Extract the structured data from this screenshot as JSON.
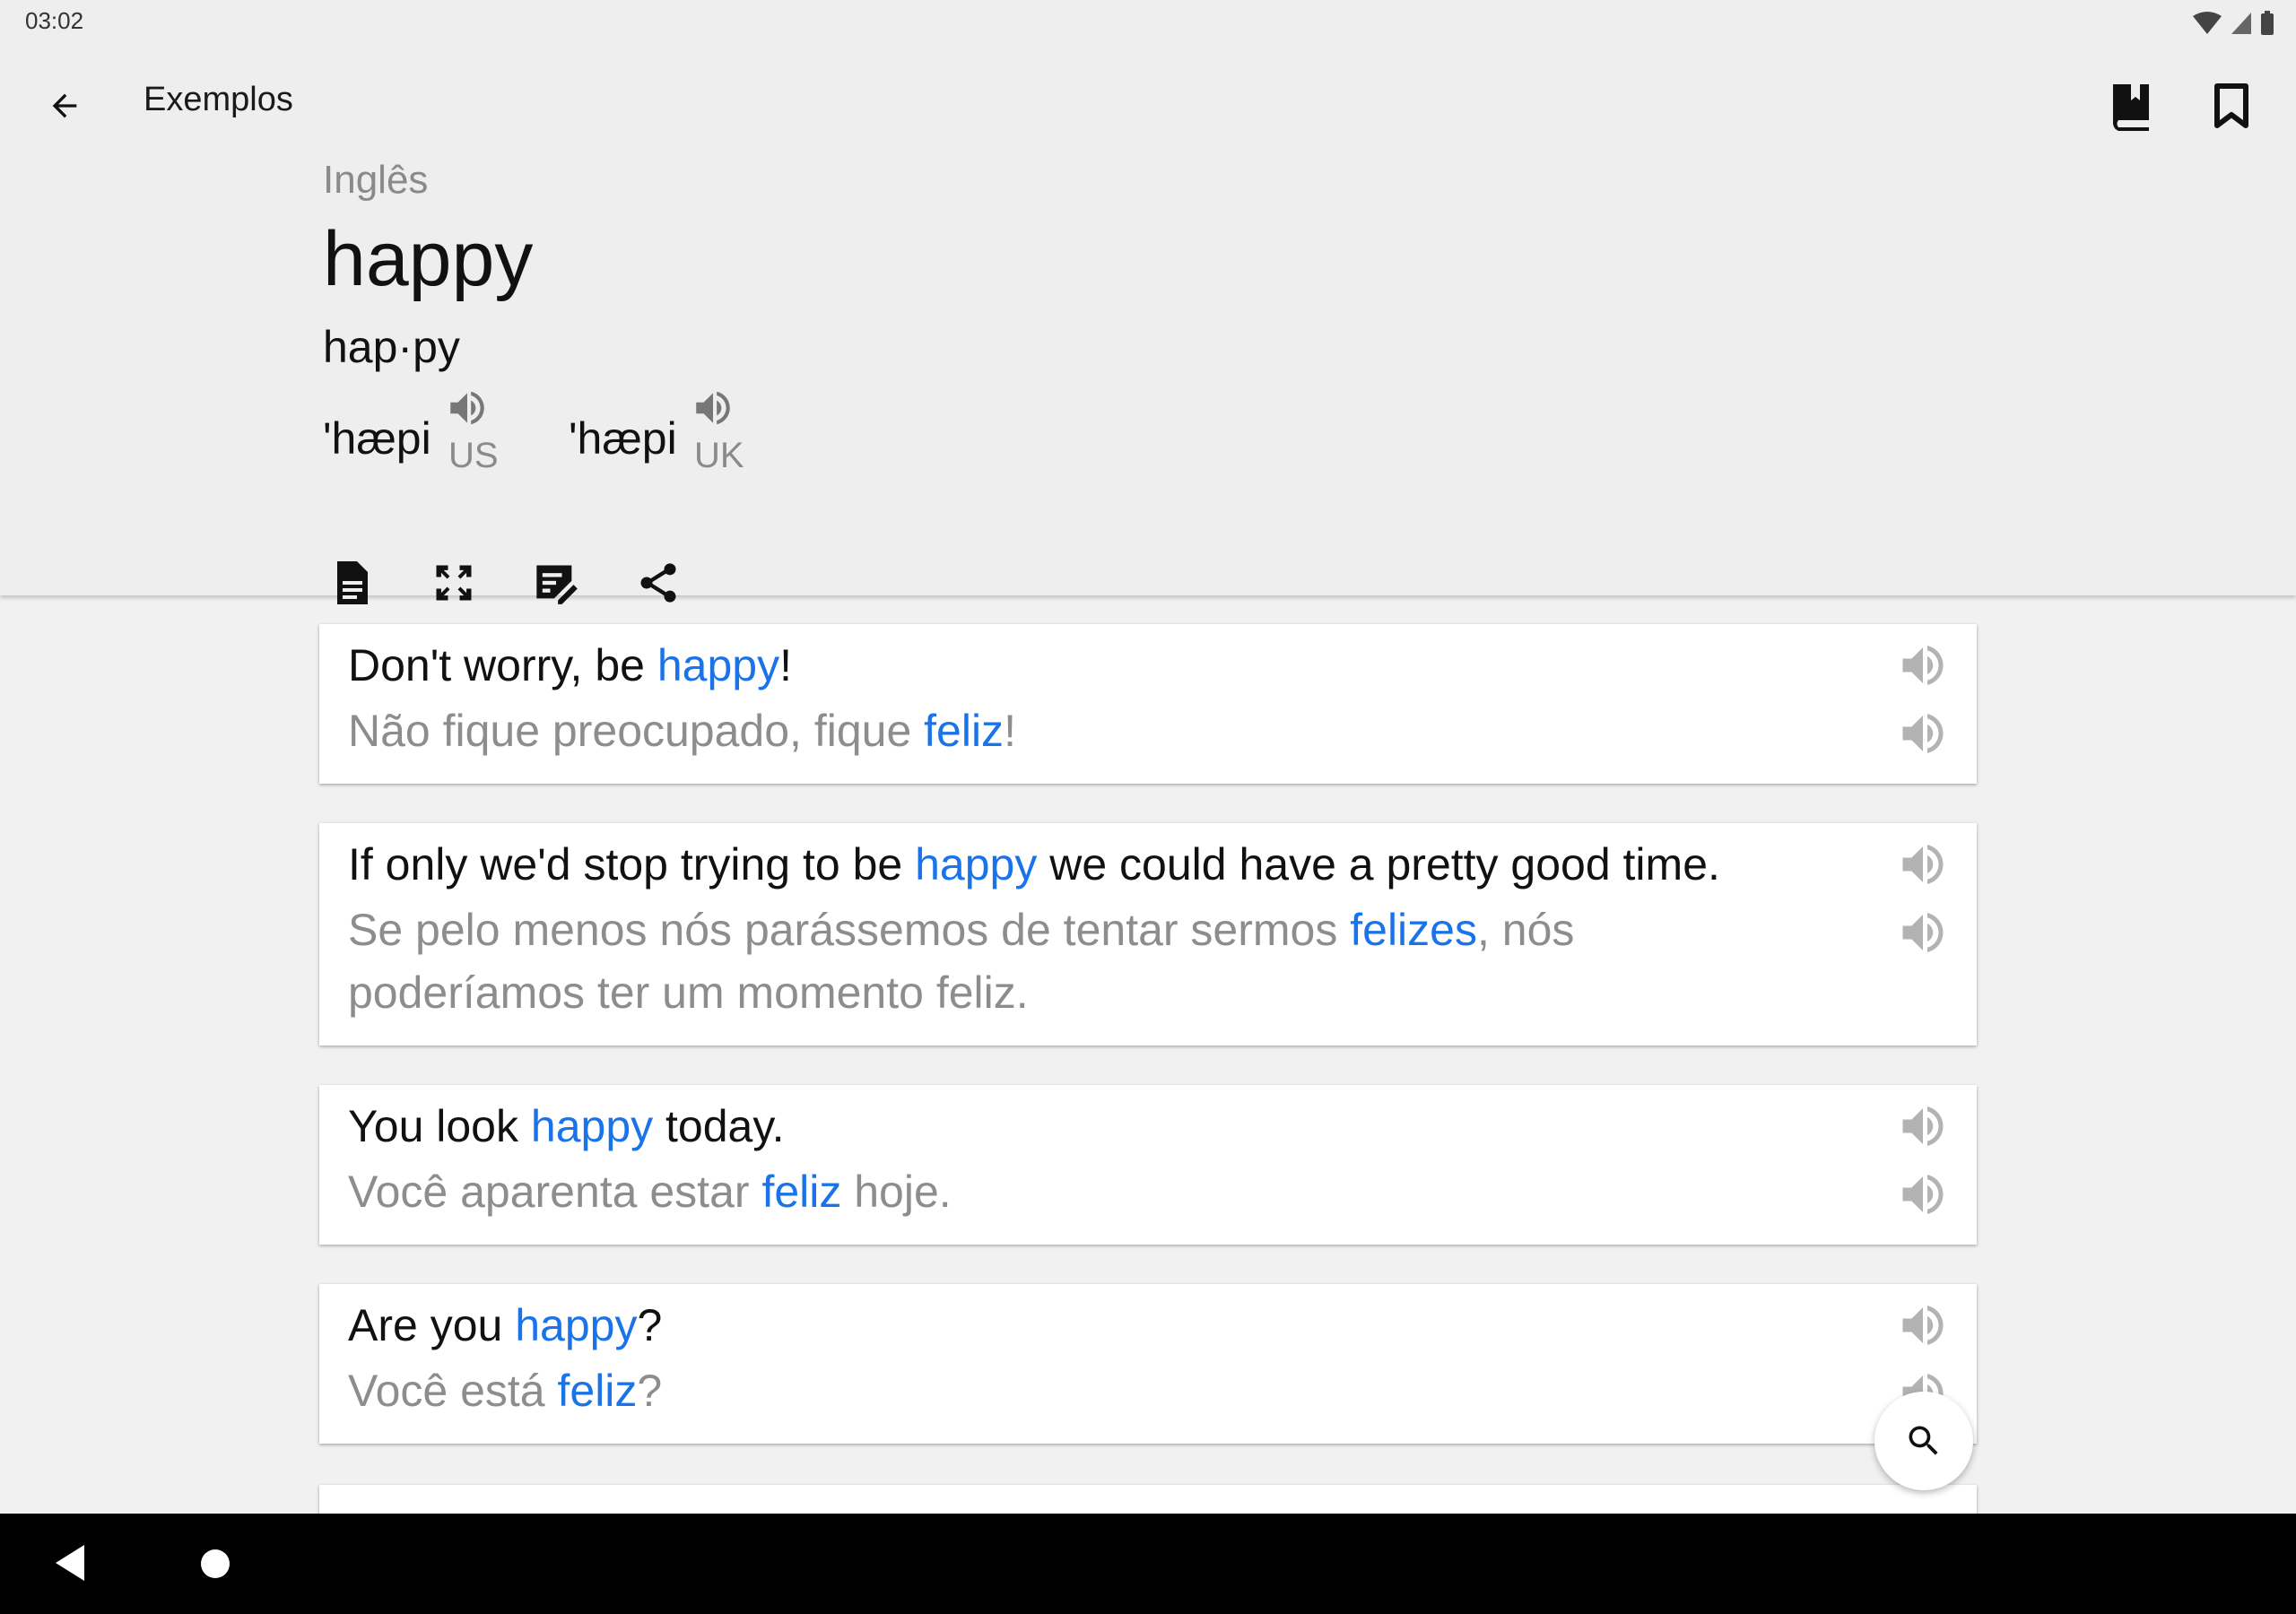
{
  "status": {
    "time": "03:02"
  },
  "header": {
    "title": "Exemplos",
    "language": "Inglês",
    "word": "happy",
    "syllabification": "hap·py",
    "pronunciations": [
      {
        "ipa": "'hæpi",
        "region": "US"
      },
      {
        "ipa": "'hæpi",
        "region": "UK"
      }
    ]
  },
  "examples": [
    {
      "en": {
        "pre": "Don't worry, be ",
        "hl": "happy",
        "post": "!"
      },
      "pt": {
        "pre": "Não fique preocupado, fique ",
        "hl": "feliz",
        "post": "!"
      }
    },
    {
      "en": {
        "pre": "If only we'd stop trying to be ",
        "hl": "happy",
        "post": " we could have a pretty good time."
      },
      "pt": {
        "pre": "Se pelo menos nós parássemos de tentar sermos ",
        "hl": "felizes",
        "post": ", nós poderíamos ter um momento feliz."
      }
    },
    {
      "en": {
        "pre": "You look ",
        "hl": "happy",
        "post": " today."
      },
      "pt": {
        "pre": "Você aparenta estar ",
        "hl": "feliz",
        "post": " hoje."
      }
    },
    {
      "en": {
        "pre": "Are you ",
        "hl": "happy",
        "post": "?"
      },
      "pt": {
        "pre": "Você está ",
        "hl": "feliz",
        "post": "?"
      }
    }
  ],
  "icons": {
    "back": "arrow-left-icon",
    "dictionary": "book-icon",
    "bookmark": "bookmark-icon",
    "document": "document-icon",
    "expand": "fullscreen-icon",
    "note": "edit-note-icon",
    "share": "share-icon",
    "speaker": "speaker-icon",
    "search": "search-icon"
  },
  "colors": {
    "highlight": "#1a73e8",
    "header_bg": "#eeeeee",
    "page_bg": "#f1f1f1"
  }
}
